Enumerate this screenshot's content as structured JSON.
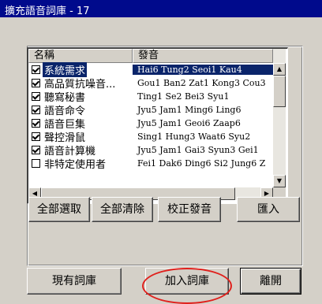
{
  "window": {
    "title": "擴充語音詞庫 - 17"
  },
  "list": {
    "columns": [
      "名稱",
      "發音"
    ],
    "rows": [
      {
        "name": "系統需求",
        "pron": "Hai6 Tung2 Seoi1 Kau4",
        "checked": true,
        "selected": true
      },
      {
        "name": "高品質抗噪音...",
        "pron": "Gou1 Ban2 Zat1 Kong3 Cou3",
        "checked": true,
        "selected": false
      },
      {
        "name": "聽寫秘書",
        "pron": "Ting1 Se2 Bei3 Syu1",
        "checked": true,
        "selected": false
      },
      {
        "name": "語音命令",
        "pron": "Jyu5 Jam1 Ming6 Ling6",
        "checked": true,
        "selected": false
      },
      {
        "name": "語音巨集",
        "pron": "Jyu5 Jam1 Geoi6 Zaap6",
        "checked": true,
        "selected": false
      },
      {
        "name": "聲控滑鼠",
        "pron": "Sing1 Hung3 Waat6 Syu2",
        "checked": true,
        "selected": false
      },
      {
        "name": "語音計算機",
        "pron": "Jyu5 Jam1 Gai3 Syun3 Gei1",
        "checked": true,
        "selected": false
      },
      {
        "name": "非特定使用者",
        "pron": "Fei1 Dak6 Ding6 Si2 Jung6 Z",
        "checked": false,
        "selected": false
      }
    ]
  },
  "scrollbar_icons": {
    "up": "▲",
    "down": "▼",
    "left": "◀",
    "right": "▶"
  },
  "buttons": {
    "select_all": "全部選取",
    "clear_all": "全部清除",
    "correct_pron": "校正發音",
    "import": "匯入",
    "existing": "現有詞庫",
    "add": "加入詞庫",
    "leave": "離開"
  },
  "colors": {
    "title_bg": "#000a8c",
    "selection": "#0a246a",
    "highlight_ellipse": "#e0201c"
  }
}
